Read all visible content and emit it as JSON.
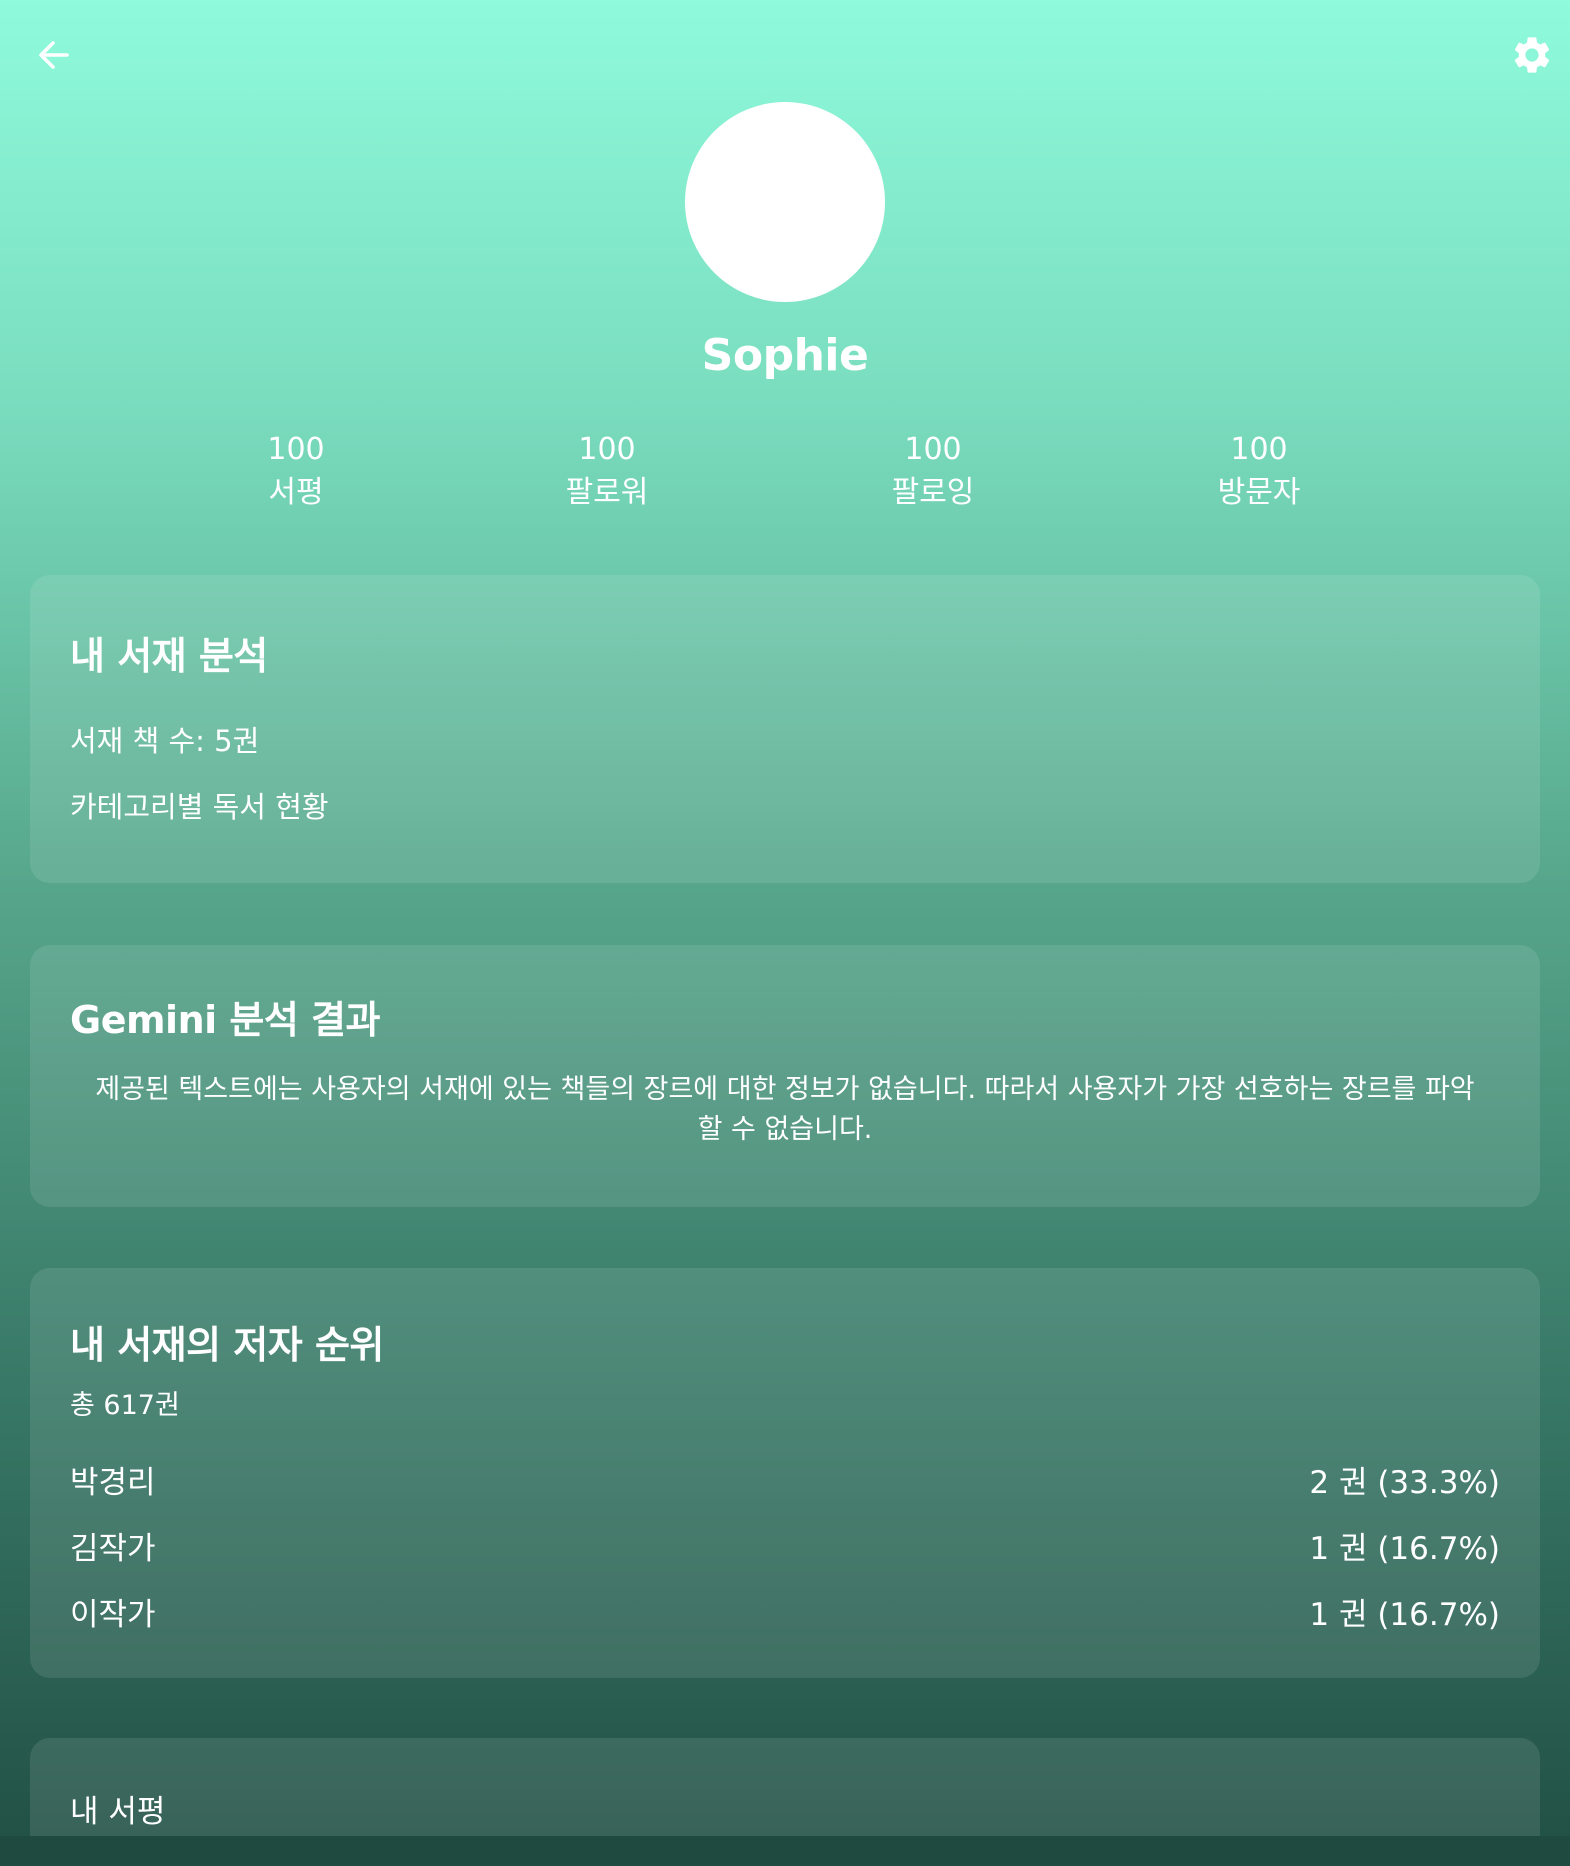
{
  "header": {
    "back_icon": "arrow-left-icon",
    "settings_icon": "gear-icon"
  },
  "profile": {
    "name": "Sophie"
  },
  "stats": [
    {
      "value": "100",
      "label": "서평"
    },
    {
      "value": "100",
      "label": "팔로워"
    },
    {
      "value": "100",
      "label": "팔로잉"
    },
    {
      "value": "100",
      "label": "방문자"
    }
  ],
  "library_analysis": {
    "title": "내 서재 분석",
    "book_count": "서재 책 수: 5권",
    "category_status": "카테고리별 독서 현황"
  },
  "gemini": {
    "title": "Gemini 분석 결과",
    "result": "제공된 텍스트에는 사용자의 서재에 있는 책들의 장르에 대한 정보가 없습니다. 따라서 사용자가 가장 선호하는 장르를 파악할 수 없습니다."
  },
  "author_ranking": {
    "title": "내 서재의 저자 순위",
    "total": "총 617권",
    "authors": [
      {
        "name": "박경리",
        "count": "2 권 (33.3%)"
      },
      {
        "name": "김작가",
        "count": "1 권 (16.7%)"
      },
      {
        "name": "이작가",
        "count": "1 권 (16.7%)"
      }
    ]
  },
  "reviews": {
    "title": "내 서평"
  }
}
